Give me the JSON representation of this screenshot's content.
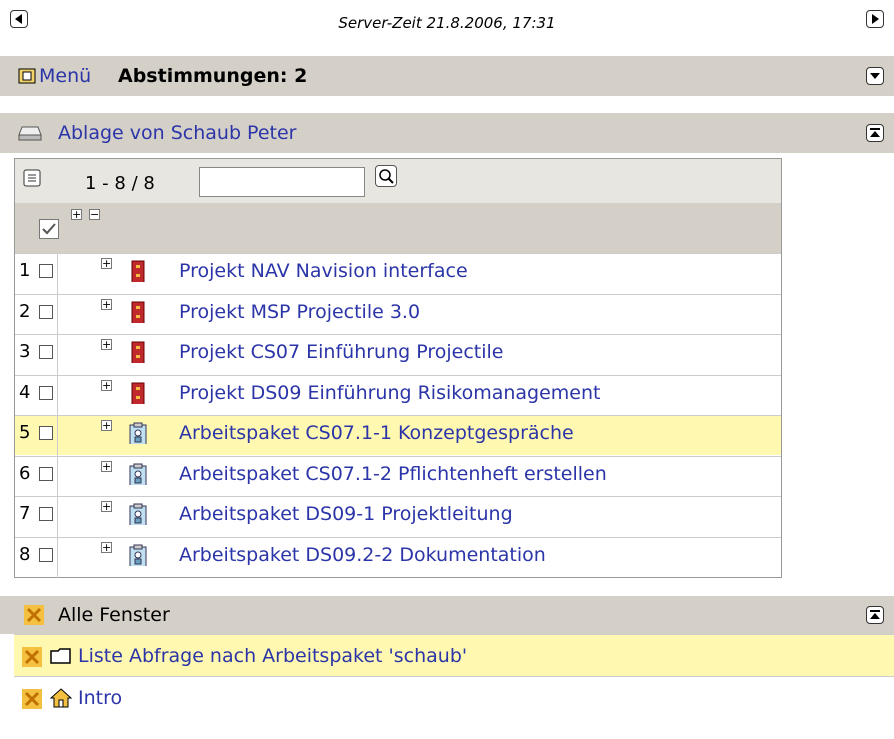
{
  "topbar": {
    "server_time": "Server-Zeit 21.8.2006, 17:31"
  },
  "menu_bar": {
    "menu_label": "Menü",
    "title": "Abstimmungen: 2"
  },
  "storage_bar": {
    "title": "Ablage von Schaub Peter"
  },
  "list": {
    "range_label": "1 - 8 / 8",
    "search_value": "",
    "rows": [
      {
        "num": "1",
        "label": "Projekt NAV Navision interface",
        "icon": "project-binder-icon"
      },
      {
        "num": "2",
        "label": "Projekt MSP Projectile 3.0",
        "icon": "project-binder-icon"
      },
      {
        "num": "3",
        "label": "Projekt CS07 Einführung Projectile",
        "icon": "project-binder-icon"
      },
      {
        "num": "4",
        "label": "Projekt DS09 Einführung Risikomanagement",
        "icon": "project-binder-icon"
      },
      {
        "num": "5",
        "label": "Arbeitspaket CS07.1-1 Konzeptgespräche",
        "icon": "workpackage-clipboard-icon"
      },
      {
        "num": "6",
        "label": "Arbeitspaket CS07.1-2 Pflichtenheft erstellen",
        "icon": "workpackage-clipboard-icon"
      },
      {
        "num": "7",
        "label": "Arbeitspaket DS09-1 Projektleitung",
        "icon": "workpackage-clipboard-icon"
      },
      {
        "num": "8",
        "label": "Arbeitspaket DS09.2-2 Dokumentation",
        "icon": "workpackage-clipboard-icon"
      }
    ]
  },
  "windows": {
    "title": "Alle Fenster",
    "items": [
      {
        "label": "Liste Abfrage nach Arbeitspaket 'schaub'",
        "icon": "folder-icon"
      },
      {
        "label": "Intro",
        "icon": "home-icon"
      }
    ]
  },
  "colors": {
    "bar_bg": "#d4d0c8",
    "link": "#2b35a8",
    "highlight": "#fff8b0"
  }
}
